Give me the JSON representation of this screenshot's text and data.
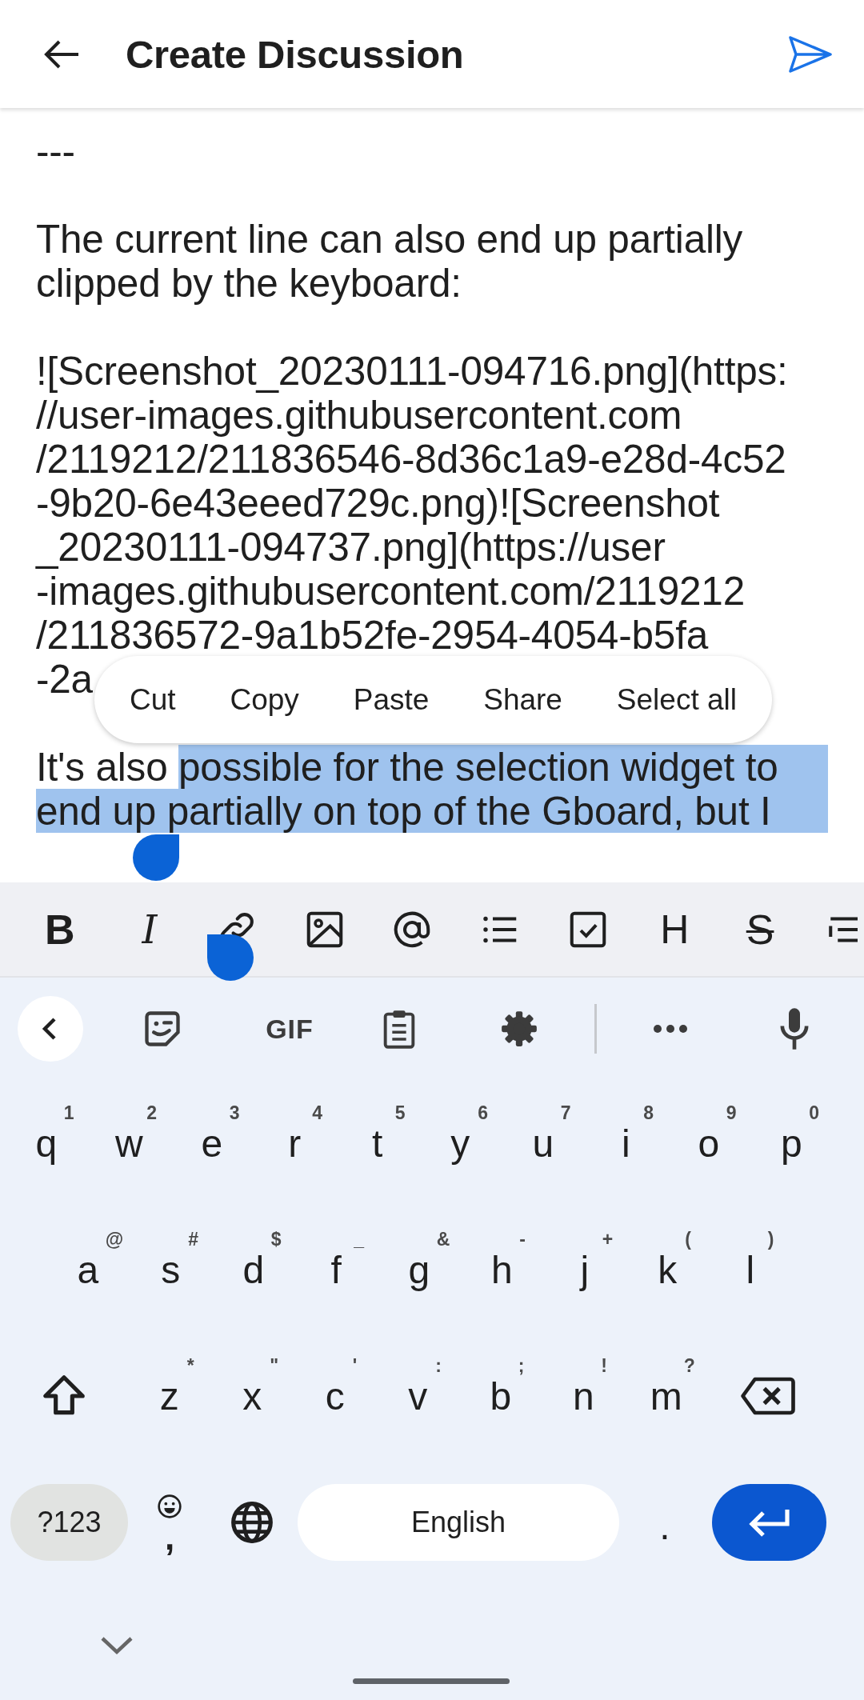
{
  "header": {
    "title": "Create Discussion"
  },
  "editor": {
    "blocks": [
      {
        "lines": [
          "---"
        ]
      },
      {
        "lines": [
          "The current line can also end up partially",
          "clipped by the keyboard:"
        ]
      },
      {
        "lines": [
          "![Screenshot_20230111-094716.png](https:",
          "//user-images.githubusercontent.com",
          "/2119212/211836546-8d36c1a9-e28d-4c52",
          "-9b20-6e43eeed729c.png)![Screenshot",
          "_20230111-094737.png](https://user",
          "-images.githubusercontent.com/2119212",
          "/211836572-9a1b52fe-2954-4054-b5fa",
          "-2a"
        ]
      }
    ],
    "selection_block": [
      [
        {
          "text": "It's also ",
          "selected": false
        },
        {
          "text": "possible for the selection widget to",
          "selected": true
        }
      ],
      [
        {
          "text": "end up partially on top of the Gboard, but I",
          "selected": true
        }
      ]
    ]
  },
  "context_menu": [
    "Cut",
    "Copy",
    "Paste",
    "Share",
    "Select all"
  ],
  "format_toolbar": [
    {
      "kind": "bold",
      "text": "B"
    },
    {
      "kind": "italic",
      "text": "I"
    },
    {
      "kind": "link"
    },
    {
      "kind": "image"
    },
    {
      "kind": "mention"
    },
    {
      "kind": "list"
    },
    {
      "kind": "task"
    },
    {
      "kind": "heading",
      "text": "H"
    },
    {
      "kind": "strike",
      "text": "S"
    },
    {
      "kind": "quote"
    }
  ],
  "keyboard": {
    "strip": [
      {
        "kind": "collapse"
      },
      {
        "kind": "sticker"
      },
      {
        "kind": "gif",
        "text": "GIF"
      },
      {
        "kind": "clipboard"
      },
      {
        "kind": "settings"
      },
      {
        "kind": "divider"
      },
      {
        "kind": "more"
      },
      {
        "kind": "mic"
      }
    ],
    "rows": [
      [
        {
          "key": "q",
          "hint": "1"
        },
        {
          "key": "w",
          "hint": "2"
        },
        {
          "key": "e",
          "hint": "3"
        },
        {
          "key": "r",
          "hint": "4"
        },
        {
          "key": "t",
          "hint": "5"
        },
        {
          "key": "y",
          "hint": "6"
        },
        {
          "key": "u",
          "hint": "7"
        },
        {
          "key": "i",
          "hint": "8"
        },
        {
          "key": "o",
          "hint": "9"
        },
        {
          "key": "p",
          "hint": "0"
        }
      ],
      [
        {
          "key": "a",
          "hint": "@"
        },
        {
          "key": "s",
          "hint": "#"
        },
        {
          "key": "d",
          "hint": "$"
        },
        {
          "key": "f",
          "hint": "_"
        },
        {
          "key": "g",
          "hint": "&"
        },
        {
          "key": "h",
          "hint": "-"
        },
        {
          "key": "j",
          "hint": "+"
        },
        {
          "key": "k",
          "hint": "("
        },
        {
          "key": "l",
          "hint": ")"
        }
      ],
      [
        {
          "key": "z",
          "hint": "*"
        },
        {
          "key": "x",
          "hint": "\""
        },
        {
          "key": "c",
          "hint": "'"
        },
        {
          "key": "v",
          "hint": ":"
        },
        {
          "key": "b",
          "hint": ";"
        },
        {
          "key": "n",
          "hint": "!"
        },
        {
          "key": "m",
          "hint": "?"
        }
      ]
    ],
    "bottom": {
      "symbols": "?123",
      "comma": ",",
      "space": "English",
      "period": "."
    }
  }
}
